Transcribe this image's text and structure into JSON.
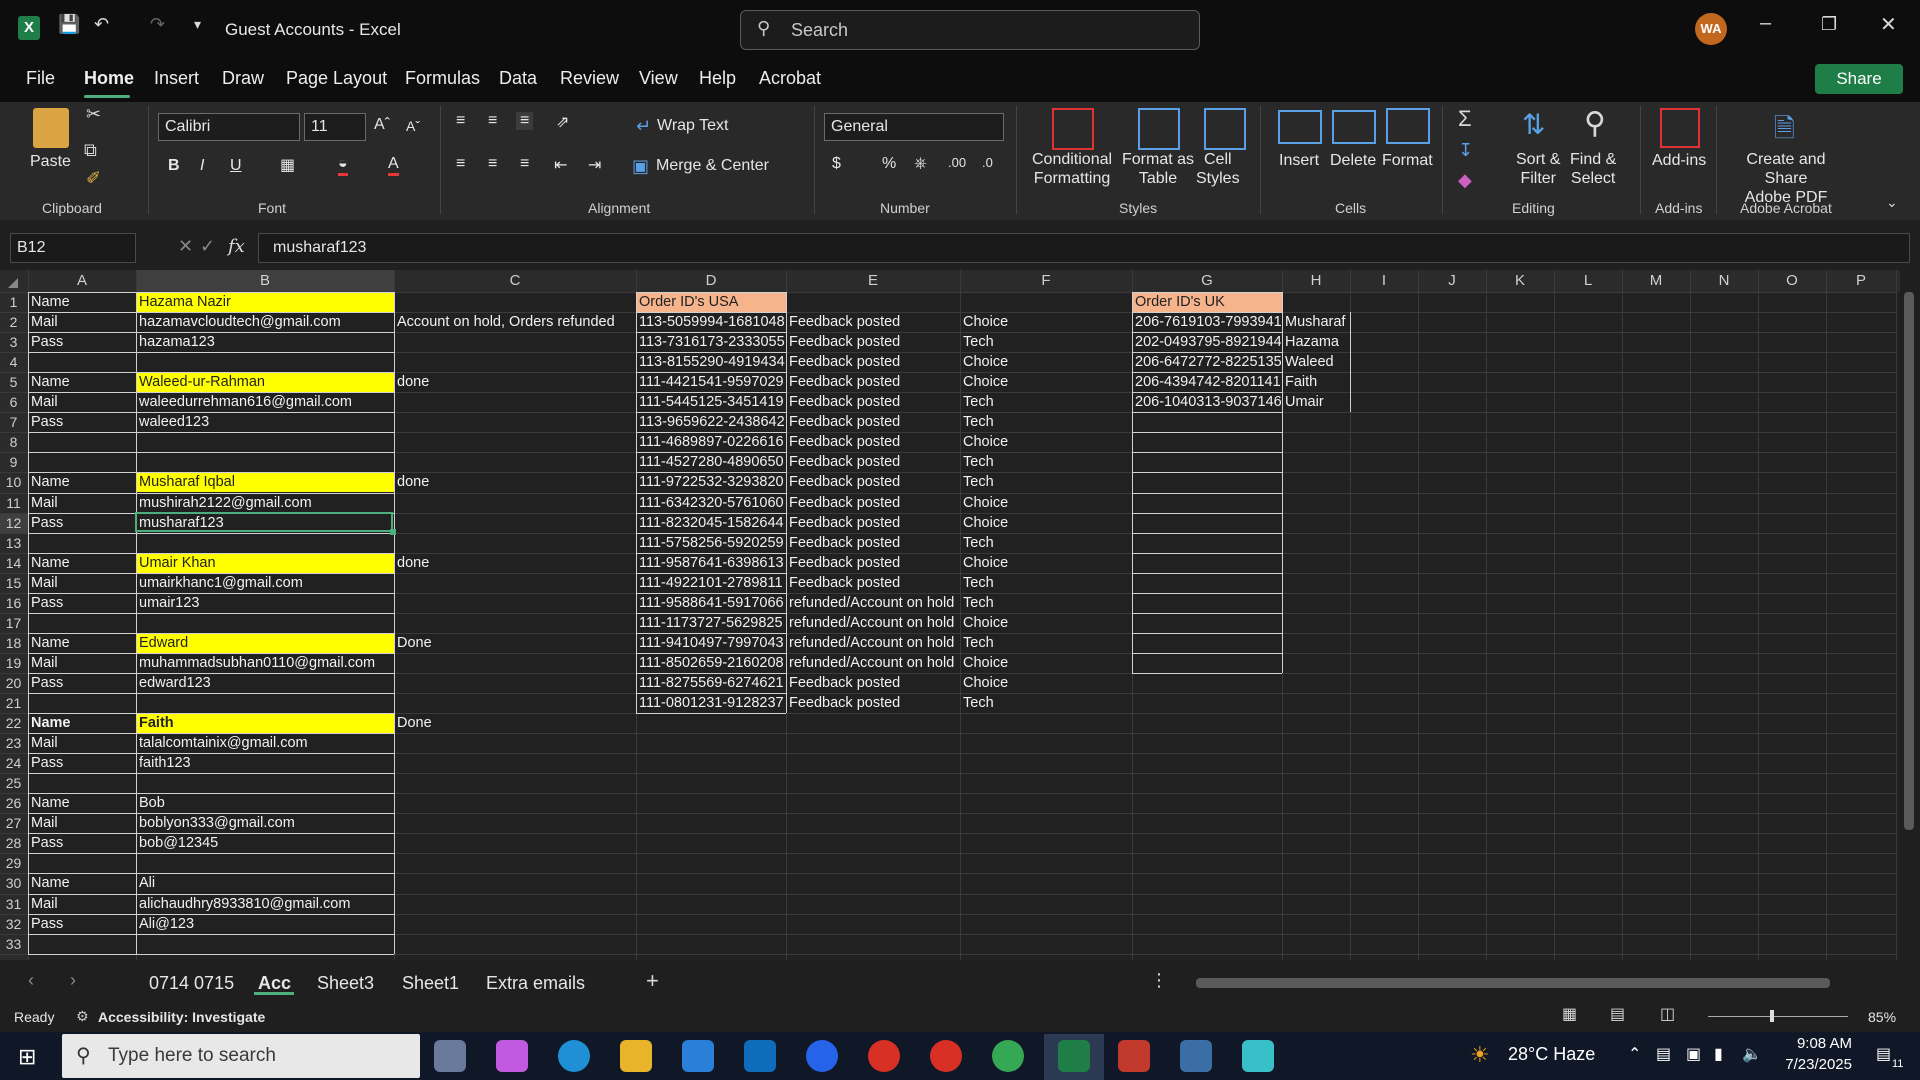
{
  "window": {
    "title": "Guest Accounts  -  Excel",
    "search_placeholder": "Search",
    "avatar": "WA"
  },
  "menu": {
    "items": [
      "File",
      "Home",
      "Insert",
      "Draw",
      "Page Layout",
      "Formulas",
      "Data",
      "Review",
      "View",
      "Help",
      "Acrobat"
    ],
    "active": "Home",
    "share": "Share"
  },
  "ribbon": {
    "clipboard": {
      "paste": "Paste",
      "label": "Clipboard"
    },
    "font": {
      "name": "Calibri",
      "size": "11",
      "label": "Font"
    },
    "alignment": {
      "wrap": "Wrap Text",
      "merge": "Merge & Center",
      "label": "Alignment"
    },
    "number": {
      "format": "General",
      "label": "Number"
    },
    "styles": {
      "conditional": [
        "Conditional",
        "Formatting"
      ],
      "format_table": [
        "Format as",
        "Table"
      ],
      "cell_styles": [
        "Cell",
        "Styles"
      ],
      "label": "Styles"
    },
    "cells": {
      "insert": "Insert",
      "delete": "Delete",
      "format": "Format",
      "label": "Cells"
    },
    "editing": {
      "sort": [
        "Sort &",
        "Filter"
      ],
      "find": [
        "Find &",
        "Select"
      ],
      "label": "Editing"
    },
    "addins": {
      "button": "Add-ins",
      "label": "Add-ins"
    },
    "acrobat": {
      "button": [
        "Create and Share",
        "Adobe PDF"
      ],
      "label": "Adobe Acrobat"
    }
  },
  "formula_bar": {
    "name_box": "B12",
    "value": "musharaf123"
  },
  "columns": [
    "A",
    "B",
    "C",
    "D",
    "E",
    "F",
    "G",
    "H",
    "I",
    "J",
    "K",
    "L",
    "M",
    "N",
    "O",
    "P"
  ],
  "rows": [
    "1",
    "2",
    "3",
    "4",
    "5",
    "6",
    "7",
    "8",
    "9",
    "10",
    "11",
    "12",
    "13",
    "14",
    "15",
    "16",
    "17",
    "18",
    "19",
    "20",
    "21",
    "22",
    "23",
    "24",
    "25",
    "26",
    "27",
    "28",
    "29",
    "30",
    "31",
    "32",
    "33"
  ],
  "sheet": {
    "colA": [
      "Name",
      "Mail",
      "Pass",
      "",
      "Name",
      "Mail",
      "Pass",
      "",
      "",
      "Name",
      "Mail",
      "Pass",
      "",
      "Name",
      "Mail",
      "Pass",
      "",
      "Name",
      "Mail",
      "Pass",
      "",
      "Name",
      "Mail",
      "Pass",
      "",
      "Name",
      "Mail",
      "Pass",
      "",
      "Name",
      "Mail",
      "Pass",
      ""
    ],
    "colB": [
      "Hazama Nazir",
      "hazamavcloudtech@gmail.com",
      "hazama123",
      "",
      "Waleed-ur-Rahman",
      "waleedurrehman616@gmail.com",
      "waleed123",
      "",
      "",
      "Musharaf Iqbal",
      "mushirah2122@gmail.com",
      "musharaf123",
      "",
      "Umair Khan",
      "umairkhanc1@gmail.com",
      "umair123",
      "",
      "Edward",
      "muhammadsubhan0110@gmail.com",
      "edward123",
      "",
      "Faith",
      "talalcomtainix@gmail.com",
      "faith123",
      "",
      "Bob",
      "boblyon333@gmail.com",
      "bob@12345",
      "",
      "Ali",
      "alichaudhry8933810@gmail.com",
      "Ali@123",
      ""
    ],
    "colC": [
      "",
      "Account on hold, Orders refunded",
      "",
      "",
      "done",
      "",
      "",
      "",
      "",
      "done",
      "",
      "",
      "",
      "done",
      "",
      "",
      "",
      "Done",
      "",
      "",
      "",
      "Done",
      "",
      "",
      "",
      "",
      "",
      "",
      "",
      "",
      "",
      "",
      ""
    ],
    "colD": [
      "Order ID's USA",
      "113-5059994-1681048",
      "113-7316173-2333055",
      "113-8155290-4919434",
      "111-4421541-9597029",
      "111-5445125-3451419",
      "113-9659622-2438642",
      "111-4689897-0226616",
      "111-4527280-4890650",
      "111-9722532-3293820",
      "111-6342320-5761060",
      "111-8232045-1582644",
      "111-5758256-5920259",
      "111-9587641-6398613",
      "111-4922101-2789811",
      "111-9588641-5917066",
      "111-1173727-5629825",
      "111-9410497-7997043",
      "111-8502659-2160208",
      "111-8275569-6274621",
      "111-0801231-9128237"
    ],
    "colE": [
      "",
      "Feedback posted",
      "Feedback posted",
      "Feedback posted",
      "Feedback posted",
      "Feedback posted",
      "Feedback posted",
      "Feedback posted",
      "Feedback posted",
      "Feedback posted",
      "Feedback posted",
      "Feedback posted",
      "Feedback posted",
      "Feedback posted",
      "Feedback posted",
      "refunded/Account on hold",
      "refunded/Account on hold",
      "refunded/Account on hold",
      "refunded/Account on hold",
      "Feedback posted",
      "Feedback posted"
    ],
    "colF": [
      "",
      "Choice",
      "Tech",
      "Choice",
      "Choice",
      "Tech",
      "Tech",
      "Choice",
      "Tech",
      "Tech",
      "Choice",
      "Choice",
      "Tech",
      "Choice",
      "Tech",
      "Tech",
      "Choice",
      "Tech",
      "Choice",
      "Choice",
      "Tech"
    ],
    "colG": [
      "Order ID's UK",
      "206-7619103-7993941",
      "202-0493795-8921944",
      " 206-6472772-8225135",
      " 206-4394742-8201141",
      "206-1040313-9037146"
    ],
    "colH": [
      "",
      "Musharaf",
      "Hazama",
      "Waleed",
      "Faith",
      "Umair"
    ]
  },
  "tabs": {
    "items": [
      "0714 0715",
      "Acc",
      "Sheet3",
      "Sheet1",
      "Extra emails"
    ],
    "active": "Acc"
  },
  "status": {
    "ready": "Ready",
    "accessibility": "Accessibility: Investigate",
    "zoom": "85%"
  },
  "taskbar": {
    "search_placeholder": "Type here to search",
    "weather": "28°C  Haze",
    "time": "9:08 AM",
    "date": "7/23/2025",
    "notif": "11"
  },
  "colors": {
    "accent": "#4caf7d",
    "highlight": "#ffff00",
    "orange": "#f5b48c",
    "excel_green": "#1f7d47"
  }
}
